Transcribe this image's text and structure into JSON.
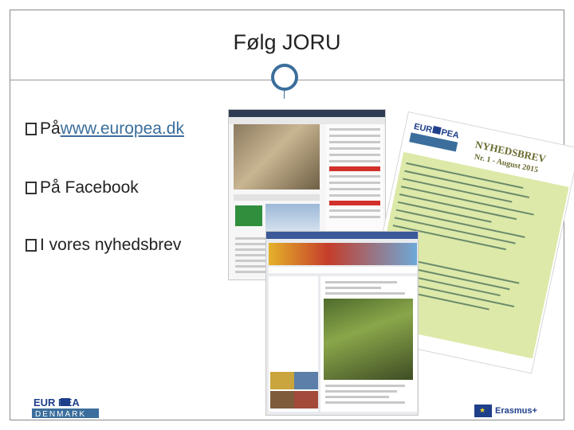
{
  "slide": {
    "title": "Følg JORU"
  },
  "bullets": [
    {
      "prefix": "På ",
      "link": "www.europea.dk",
      "suffix": ""
    },
    {
      "prefix": "På Facebook",
      "link": "",
      "suffix": ""
    },
    {
      "prefix": "I vores nyhedsbrev",
      "link": "",
      "suffix": ""
    }
  ],
  "newsletter": {
    "heading": "NYHEDSBREV",
    "issue": "Nr. 1 - August 2015"
  },
  "logos": {
    "europea_top": "EUR  PEA",
    "europea_bottom": "DENMARK",
    "erasmus": "Erasmus+"
  },
  "colors": {
    "accent": "#3b6e9c",
    "facebook": "#3b5998",
    "erasmus": "#1e3f8a"
  }
}
